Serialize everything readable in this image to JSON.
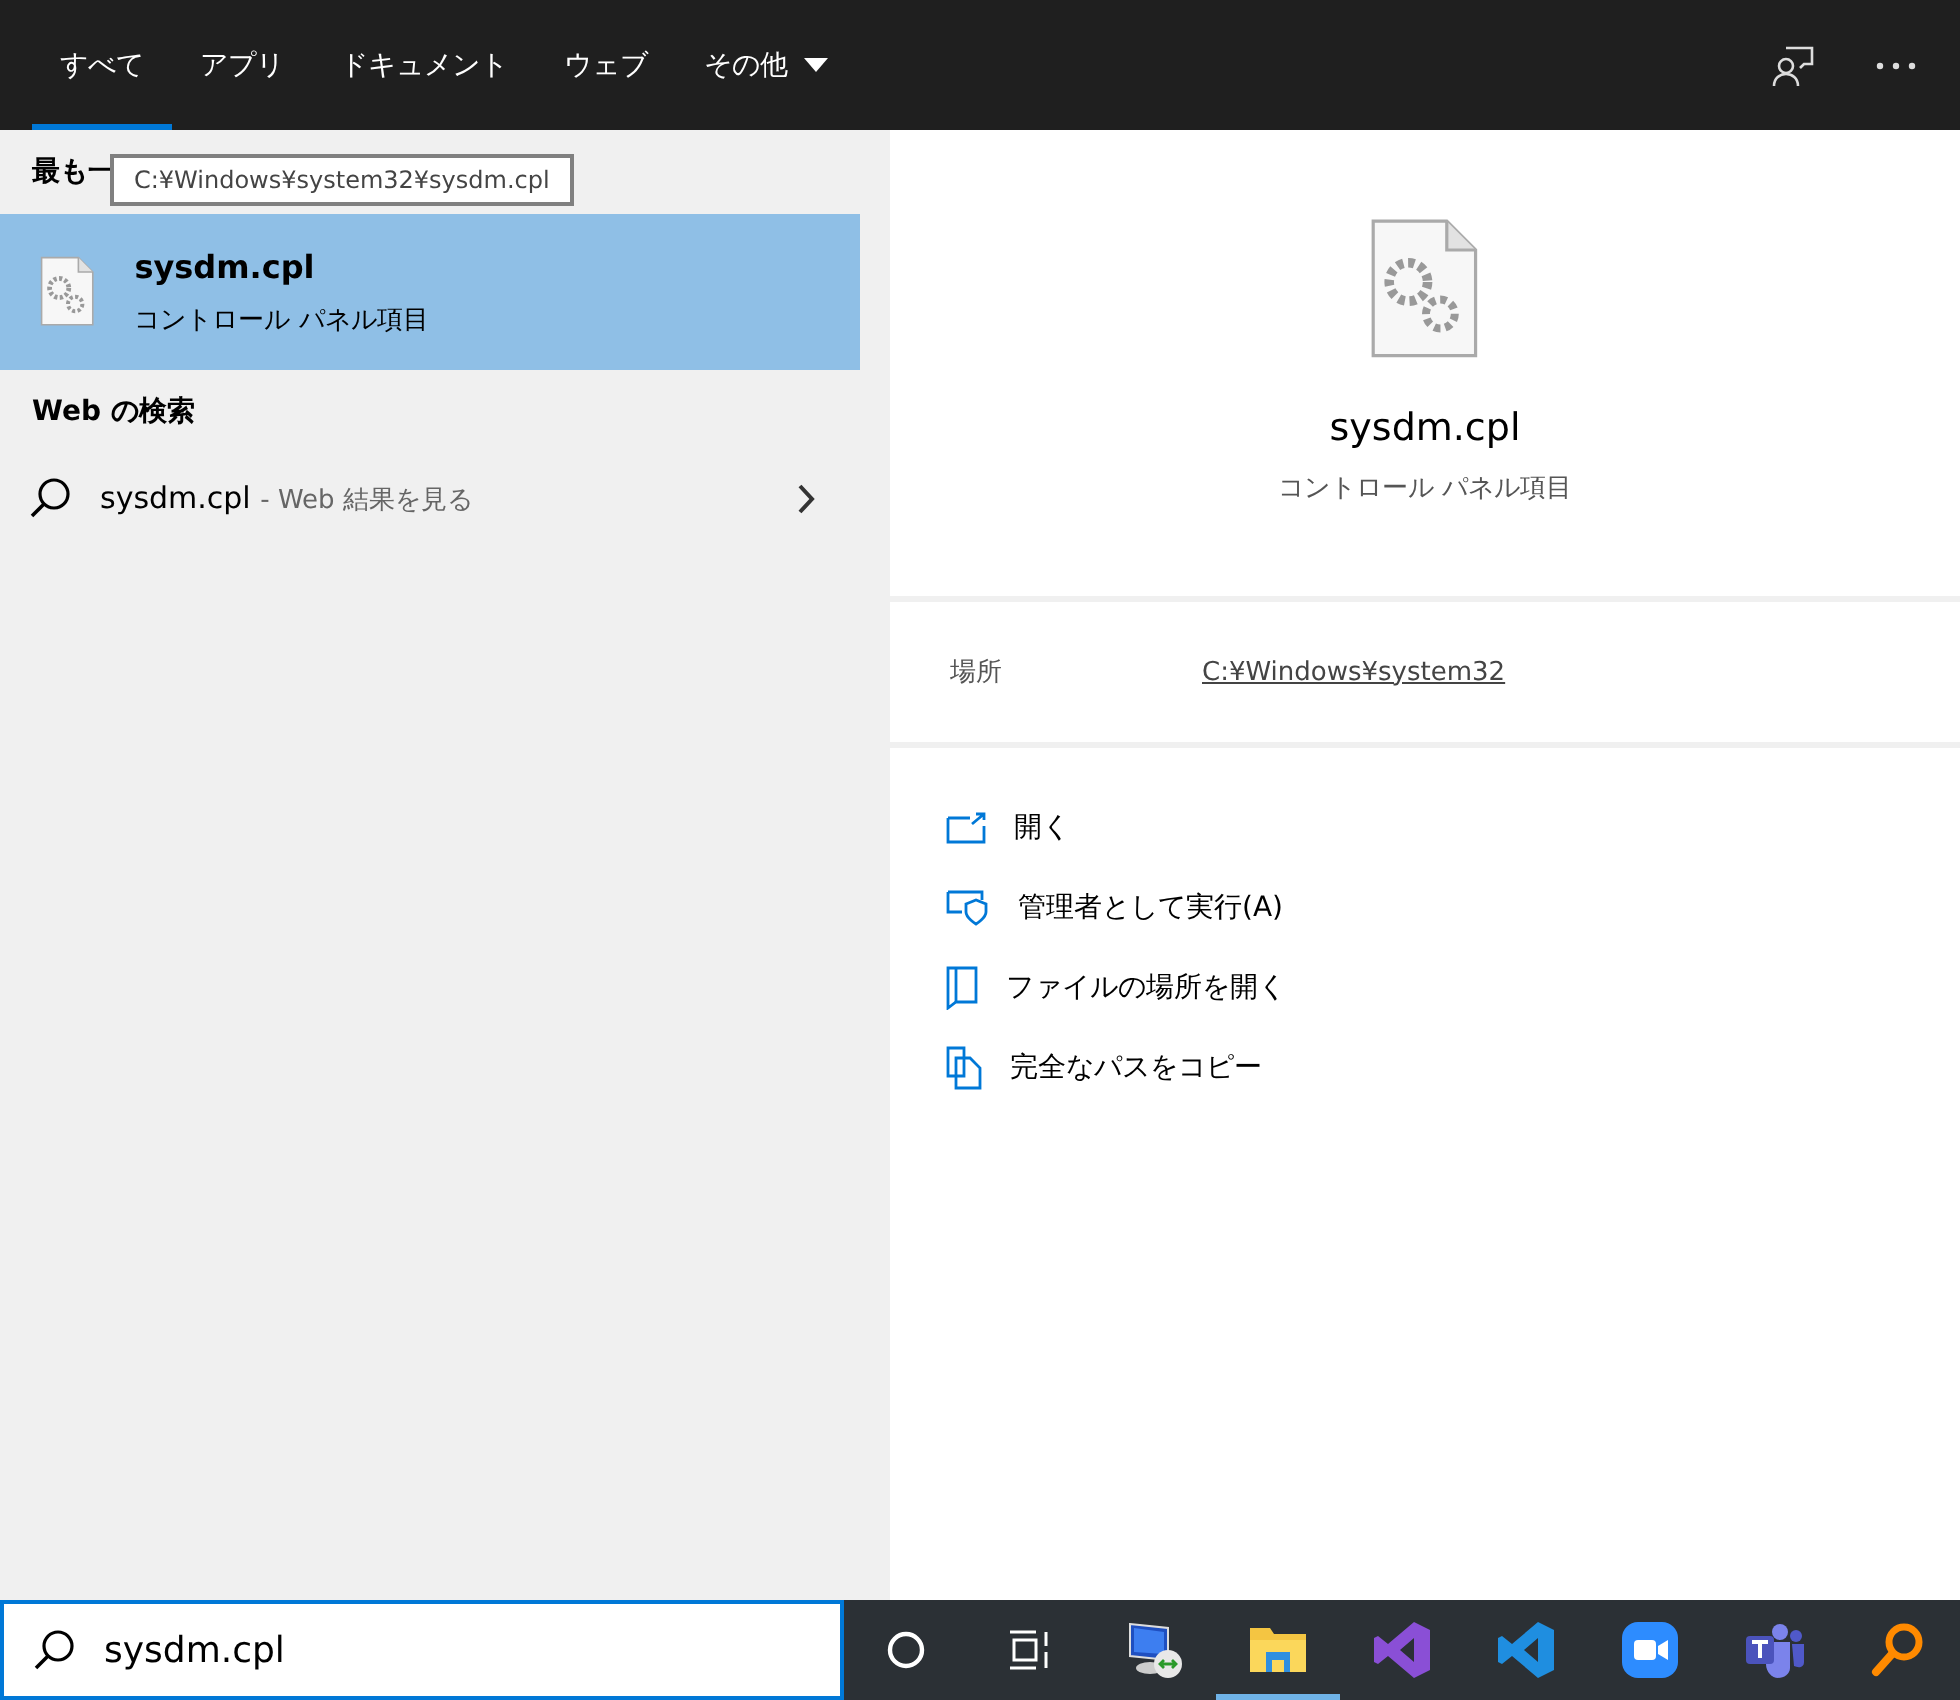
{
  "tabs": [
    {
      "label": "すべて",
      "selected": true,
      "dropdown": false
    },
    {
      "label": "アプリ",
      "selected": false,
      "dropdown": false
    },
    {
      "label": "ドキュメント",
      "selected": false,
      "dropdown": false
    },
    {
      "label": "ウェブ",
      "selected": false,
      "dropdown": false
    },
    {
      "label": "その他",
      "selected": false,
      "dropdown": true
    }
  ],
  "best_match": {
    "heading": "最も一",
    "tooltip": "C:¥Windows¥system32¥sysdm.cpl",
    "item": {
      "title": "sysdm.cpl",
      "subtitle": "コントロール パネル項目",
      "selected": true
    }
  },
  "web_search": {
    "heading": "Web の検索",
    "item": {
      "query": "sysdm.cpl",
      "suffix": "- Web 結果を見る"
    }
  },
  "preview": {
    "title": "sysdm.cpl",
    "subtitle": "コントロール パネル項目"
  },
  "location": {
    "label": "場所",
    "value": "C:¥Windows¥system32"
  },
  "actions": [
    {
      "kind": "open",
      "label": "開く"
    },
    {
      "kind": "admin",
      "label": "管理者として実行(A)"
    },
    {
      "kind": "folder",
      "label": "ファイルの場所を開く"
    },
    {
      "kind": "copy",
      "label": "完全なパスをコピー"
    }
  ],
  "search_box": {
    "value": "sysdm.cpl"
  },
  "taskbar": [
    {
      "kind": "cortana",
      "active": false
    },
    {
      "kind": "taskview",
      "active": false
    },
    {
      "kind": "remote",
      "active": false
    },
    {
      "kind": "explorer",
      "active": true
    },
    {
      "kind": "vs",
      "active": false
    },
    {
      "kind": "vscode",
      "active": false
    },
    {
      "kind": "zoom",
      "active": false
    },
    {
      "kind": "teams",
      "active": false
    },
    {
      "kind": "search",
      "active": false
    }
  ]
}
